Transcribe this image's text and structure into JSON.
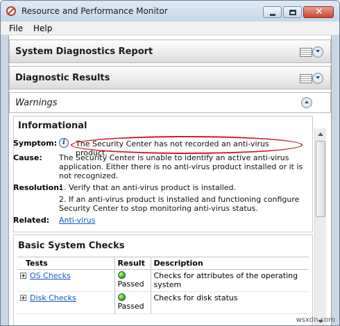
{
  "window": {
    "title": "Resource and Performance Monitor"
  },
  "menu": {
    "items": [
      "File",
      "Help"
    ]
  },
  "sections": {
    "system_diagnostics": "System Diagnostics Report",
    "diagnostic_results": "Diagnostic Results",
    "warnings": "Warnings"
  },
  "informational": {
    "title": "Informational",
    "symptom_label": "Symptom:",
    "symptom_text": "The Security Center has not recorded an anti-virus product.",
    "cause_label": "Cause:",
    "cause_text": "The Security Center is unable to identify an active anti-virus application. Either there is no anti-virus product installed or it is not recognized.",
    "resolution_label": "Resolution:",
    "resolution_1": "1. Verify that an anti-virus product is installed.",
    "resolution_2": "2. If an anti-virus product is installed and functioning configure Security Center to stop monitoring anti-virus status.",
    "related_label": "Related:",
    "related_link": "Anti-virus"
  },
  "basic_checks": {
    "title": "Basic System Checks",
    "columns": [
      "Tests",
      "Result",
      "Description"
    ],
    "rows": [
      {
        "test": "OS Checks",
        "result": "Passed",
        "description": "Checks for attributes of the operating system"
      },
      {
        "test": "Disk Checks",
        "result": "Passed",
        "description": "Checks for disk status"
      }
    ]
  },
  "icons": {
    "app": "no-entry-icon",
    "report_view": "report-view-icon",
    "collapse": "chevron-up-icon",
    "expand": "chevron-down-icon",
    "info": "info-icon",
    "passed": "green-check-icon"
  },
  "colors": {
    "highlight_ellipse": "#d0192b",
    "link": "#1155cc",
    "passed": "#2c9a16"
  },
  "watermark": "wsxdn.com"
}
